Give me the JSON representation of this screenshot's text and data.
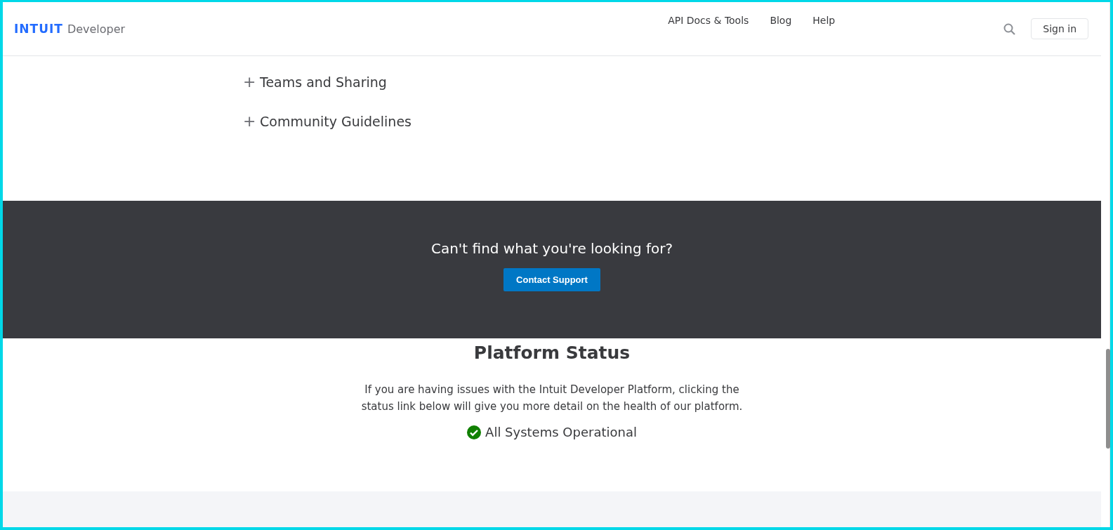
{
  "header": {
    "logo": {
      "brand": "INTUIT",
      "product": "Developer"
    },
    "nav": [
      {
        "label": "API Docs & Tools"
      },
      {
        "label": "Blog"
      },
      {
        "label": "Help"
      }
    ],
    "sign_in": "Sign in"
  },
  "accordion": [
    {
      "label": "Teams and Sharing",
      "expanded": false,
      "icon": "+"
    },
    {
      "label": "Community Guidelines",
      "expanded": false,
      "icon": "+"
    }
  ],
  "support": {
    "heading": "Can't find what you're looking for?",
    "button": "Contact Support"
  },
  "status": {
    "heading": "Platform Status",
    "description": "If you are having issues with the Intuit Developer Platform, clicking the status link below will give you more detail on the health of our platform.",
    "link": "All Systems Operational",
    "operational": true
  }
}
